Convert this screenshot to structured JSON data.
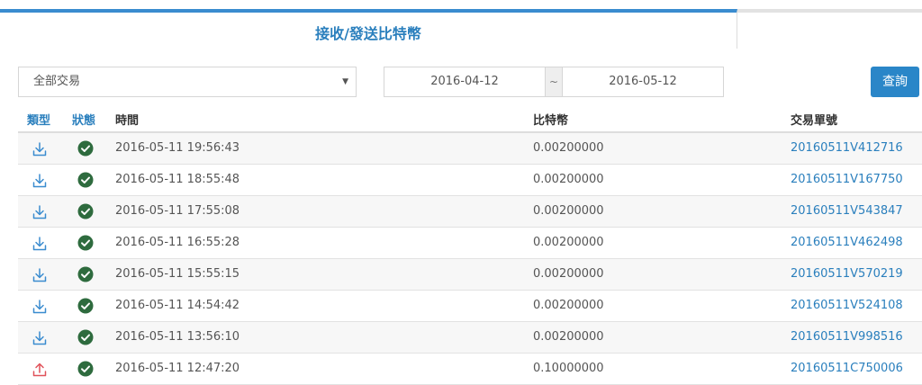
{
  "tabs": {
    "active_label": "接收/發送比特幣",
    "inactive_label": ""
  },
  "filter": {
    "type_selected": "全部交易",
    "date_from": "2016-04-12",
    "date_separator": "~",
    "date_to": "2016-05-12",
    "search_label": "查詢"
  },
  "table": {
    "headers": {
      "type": "類型",
      "status": "狀態",
      "time": "時間",
      "amount": "比特幣",
      "txid": "交易單號"
    },
    "rows": [
      {
        "direction": "receive",
        "type_icon": "download-icon",
        "status_icon": "check-circle-icon",
        "time": "2016-05-11 19:56:43",
        "amount": "0.00200000",
        "txid": "20160511V412716"
      },
      {
        "direction": "receive",
        "type_icon": "download-icon",
        "status_icon": "check-circle-icon",
        "time": "2016-05-11 18:55:48",
        "amount": "0.00200000",
        "txid": "20160511V167750"
      },
      {
        "direction": "receive",
        "type_icon": "download-icon",
        "status_icon": "check-circle-icon",
        "time": "2016-05-11 17:55:08",
        "amount": "0.00200000",
        "txid": "20160511V543847"
      },
      {
        "direction": "receive",
        "type_icon": "download-icon",
        "status_icon": "check-circle-icon",
        "time": "2016-05-11 16:55:28",
        "amount": "0.00200000",
        "txid": "20160511V462498"
      },
      {
        "direction": "receive",
        "type_icon": "download-icon",
        "status_icon": "check-circle-icon",
        "time": "2016-05-11 15:55:15",
        "amount": "0.00200000",
        "txid": "20160511V570219"
      },
      {
        "direction": "receive",
        "type_icon": "download-icon",
        "status_icon": "check-circle-icon",
        "time": "2016-05-11 14:54:42",
        "amount": "0.00200000",
        "txid": "20160511V524108"
      },
      {
        "direction": "receive",
        "type_icon": "download-icon",
        "status_icon": "check-circle-icon",
        "time": "2016-05-11 13:56:10",
        "amount": "0.00200000",
        "txid": "20160511V998516"
      },
      {
        "direction": "send",
        "type_icon": "upload-icon",
        "status_icon": "check-circle-icon",
        "time": "2016-05-11 12:47:20",
        "amount": "0.10000000",
        "txid": "20160511C750006"
      }
    ]
  },
  "colors": {
    "accent": "#2a86c8",
    "receive_icon": "#3a8ccf",
    "send_icon": "#e0525a",
    "success": "#2e6b3e"
  }
}
